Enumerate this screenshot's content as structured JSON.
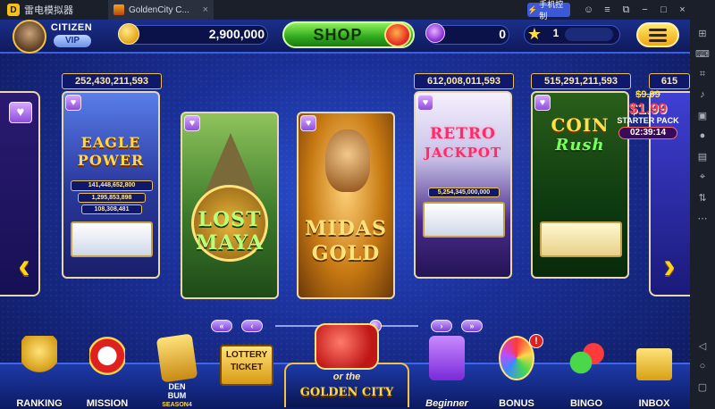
{
  "window": {
    "app_name": "雷电模拟器",
    "tab_title": "GoldenCity C...",
    "tab_close": "×",
    "phone_control": "手机控制",
    "controls": [
      "☺",
      "≡",
      "⧉",
      "−",
      "□",
      "×"
    ]
  },
  "side_toolbar": {
    "icons": [
      "grid-icon",
      "gamepad-icon",
      "keyboard-icon",
      "volume-icon",
      "screen-icon",
      "record-icon",
      "folder-icon",
      "location-icon",
      "shake-icon",
      "more-icon",
      "back-icon",
      "home-icon",
      "recent-icon"
    ],
    "glyphs": [
      "⊞",
      "⌨",
      "⌗",
      "♪",
      "▣",
      "●",
      "▤",
      "⌖",
      "⇅",
      "⋯",
      "◁",
      "○",
      "▢"
    ]
  },
  "topbar": {
    "rank": "CITIZEN",
    "vip": "VIP",
    "coins": "2,900,000",
    "shop": "SHOP",
    "gems": "0",
    "level": "1"
  },
  "slots": {
    "eagle": {
      "jackpot": "252,430,211,593",
      "title_1": "EAGLE",
      "title_2": "POWER",
      "line_1": "141,448,652,800",
      "line_2": "1,295,853,898",
      "line_3": "108,308,481"
    },
    "lost_maya": {
      "title_1": "LOST",
      "title_2": "MAYA"
    },
    "midas": {
      "title_1": "MIDAS",
      "title_2": "GOLD"
    },
    "retro": {
      "jackpot": "612,008,011,593",
      "title_1": "RETRO",
      "title_2": "JACKPOT",
      "line_1": "5,254,345,000,000"
    },
    "coin_rush": {
      "jackpot": "515,291,211,593",
      "title_1": "COIN",
      "title_2": "Rush"
    },
    "far_right": {
      "jackpot": "615"
    },
    "fav": "♥"
  },
  "starter_pack": {
    "old_price": "$9.99",
    "price": "$1.99",
    "label": "STARTER PACK",
    "timer": "02:39:14"
  },
  "pager": {
    "first": "«",
    "prev": "‹",
    "next": "›",
    "last": "»",
    "position": 0.7
  },
  "arrows": {
    "left": "‹",
    "right": "›"
  },
  "nav": {
    "ranking": "RANKING",
    "mission": "MISSION",
    "album_1": "DEN",
    "album_2": "BUM",
    "album_3": "SEASON4",
    "lottery_1": "LOTTERY",
    "lottery_2": "TICKET",
    "golden_sub": "or the",
    "golden_city": "GOLDEN CITY",
    "beginner": "Beginner",
    "bonus": "BONUS",
    "bonus_badge": "!",
    "bingo": "BINGO",
    "inbox": "INBOX"
  }
}
